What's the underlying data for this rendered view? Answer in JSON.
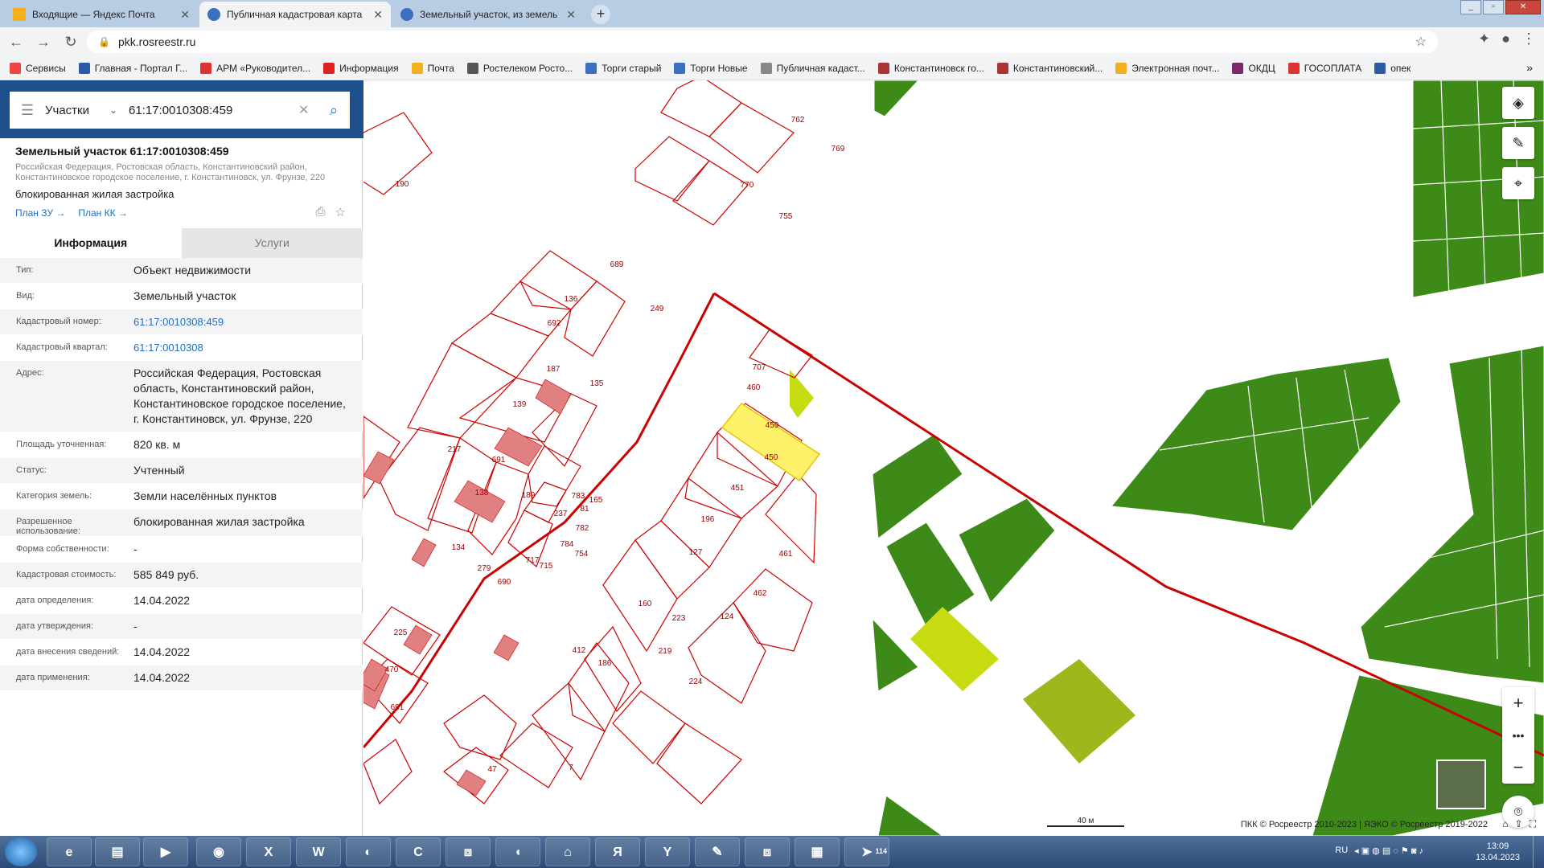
{
  "browser": {
    "tabs": [
      {
        "title": "Входящие — Яндекс Почта",
        "color": "#f2b01e"
      },
      {
        "title": "Публичная кадастровая карта",
        "color": "#3a6fc2"
      },
      {
        "title": "Земельный участок, из земель",
        "color": "#3a6fc2"
      }
    ],
    "url": "pkk.rosreestr.ru",
    "bookmarks": [
      {
        "label": "Сервисы",
        "color": "#e44"
      },
      {
        "label": "Главная - Портал Г...",
        "color": "#2b5aa8"
      },
      {
        "label": "АРМ «Руководител...",
        "color": "#d33"
      },
      {
        "label": "Информация",
        "color": "#d22"
      },
      {
        "label": "Почта",
        "color": "#f2b01e"
      },
      {
        "label": "Ростелеком Росто...",
        "color": "#555"
      },
      {
        "label": "Торги старый",
        "color": "#3a6fc2"
      },
      {
        "label": "Торги Новые",
        "color": "#3a6fc2"
      },
      {
        "label": "Публичная кадаст...",
        "color": "#888"
      },
      {
        "label": "Константиновск го...",
        "color": "#a33"
      },
      {
        "label": "Константиновский...",
        "color": "#a33"
      },
      {
        "label": "Электронная почт...",
        "color": "#f2b01e"
      },
      {
        "label": "ОКДЦ",
        "color": "#7a2a6a"
      },
      {
        "label": "ГОСОПЛАТА",
        "color": "#d33"
      },
      {
        "label": "опек",
        "color": "#2b5aa8"
      }
    ]
  },
  "search": {
    "type_label": "Участки",
    "value": "61:17:0010308:459"
  },
  "object": {
    "title": "Земельный участок 61:17:0010308:459",
    "address_line": "Российская Федерация, Ростовская область, Константиновский район, Константиновское городское поселение, г. Константиновск, ул. Фрунзе, 220",
    "use": "блокированная жилая застройка",
    "plan_zu": "План ЗУ →",
    "plan_kk": "План КК →"
  },
  "panel_tabs": {
    "info": "Информация",
    "services": "Услуги"
  },
  "properties": [
    {
      "key": "Тип:",
      "value": "Объект недвижимости"
    },
    {
      "key": "Вид:",
      "value": "Земельный участок"
    },
    {
      "key": "Кадастровый номер:",
      "value": "61:17:0010308:459",
      "link": true
    },
    {
      "key": "Кадастровый квартал:",
      "value": "61:17:0010308",
      "link": true
    },
    {
      "key": "Адрес:",
      "value": "Российская Федерация, Ростовская область, Константиновский район, Константиновское городское поселение, г. Константиновск, ул. Фрунзе, 220"
    },
    {
      "key": "Площадь уточненная:",
      "value": "820 кв. м"
    },
    {
      "key": "Статус:",
      "value": "Учтенный"
    },
    {
      "key": "Категория земель:",
      "value": "Земли населённых пунктов"
    },
    {
      "key": "Разрешенное использование:",
      "value": "блокированная жилая застройка"
    },
    {
      "key": "Форма собственности:",
      "value": "-"
    },
    {
      "key": "Кадастровая стоимость:",
      "value": "585 849 руб."
    },
    {
      "key": "дата определения:",
      "value": "14.04.2022"
    },
    {
      "key": "дата утверждения:",
      "value": "-"
    },
    {
      "key": "дата внесения сведений:",
      "value": "14.04.2022"
    },
    {
      "key": "дата применения:",
      "value": "14.04.2022"
    }
  ],
  "map": {
    "parcel_labels": [
      "762",
      "769",
      "770",
      "755",
      "190",
      "689",
      "136",
      "249",
      "692",
      "187",
      "135",
      "139",
      "691",
      "217",
      "189",
      "138",
      "237",
      "134",
      "279",
      "81",
      "165",
      "782",
      "783",
      "784",
      "754",
      "717",
      "715",
      "690",
      "707",
      "460",
      "459",
      "450",
      "451",
      "196",
      "127",
      "461",
      "412",
      "462",
      "223",
      "160",
      "124",
      "186",
      "224",
      "219",
      "225",
      "470",
      "691",
      "47",
      "7"
    ],
    "scale_label": "40 м",
    "attribution": "ПКК © Росреестр 2010-2023 | ЯЭКО © Росреестр 2019-2022",
    "colors": {
      "parcel": "#cc0000",
      "selected": "#fff26b",
      "forest": "#3e8a18",
      "lime": "#c6dc10",
      "building": "#e08080"
    }
  },
  "taskbar": {
    "lang": "RU",
    "time": "13:09",
    "date": "13.04.2023",
    "telegram_badge": "114"
  }
}
